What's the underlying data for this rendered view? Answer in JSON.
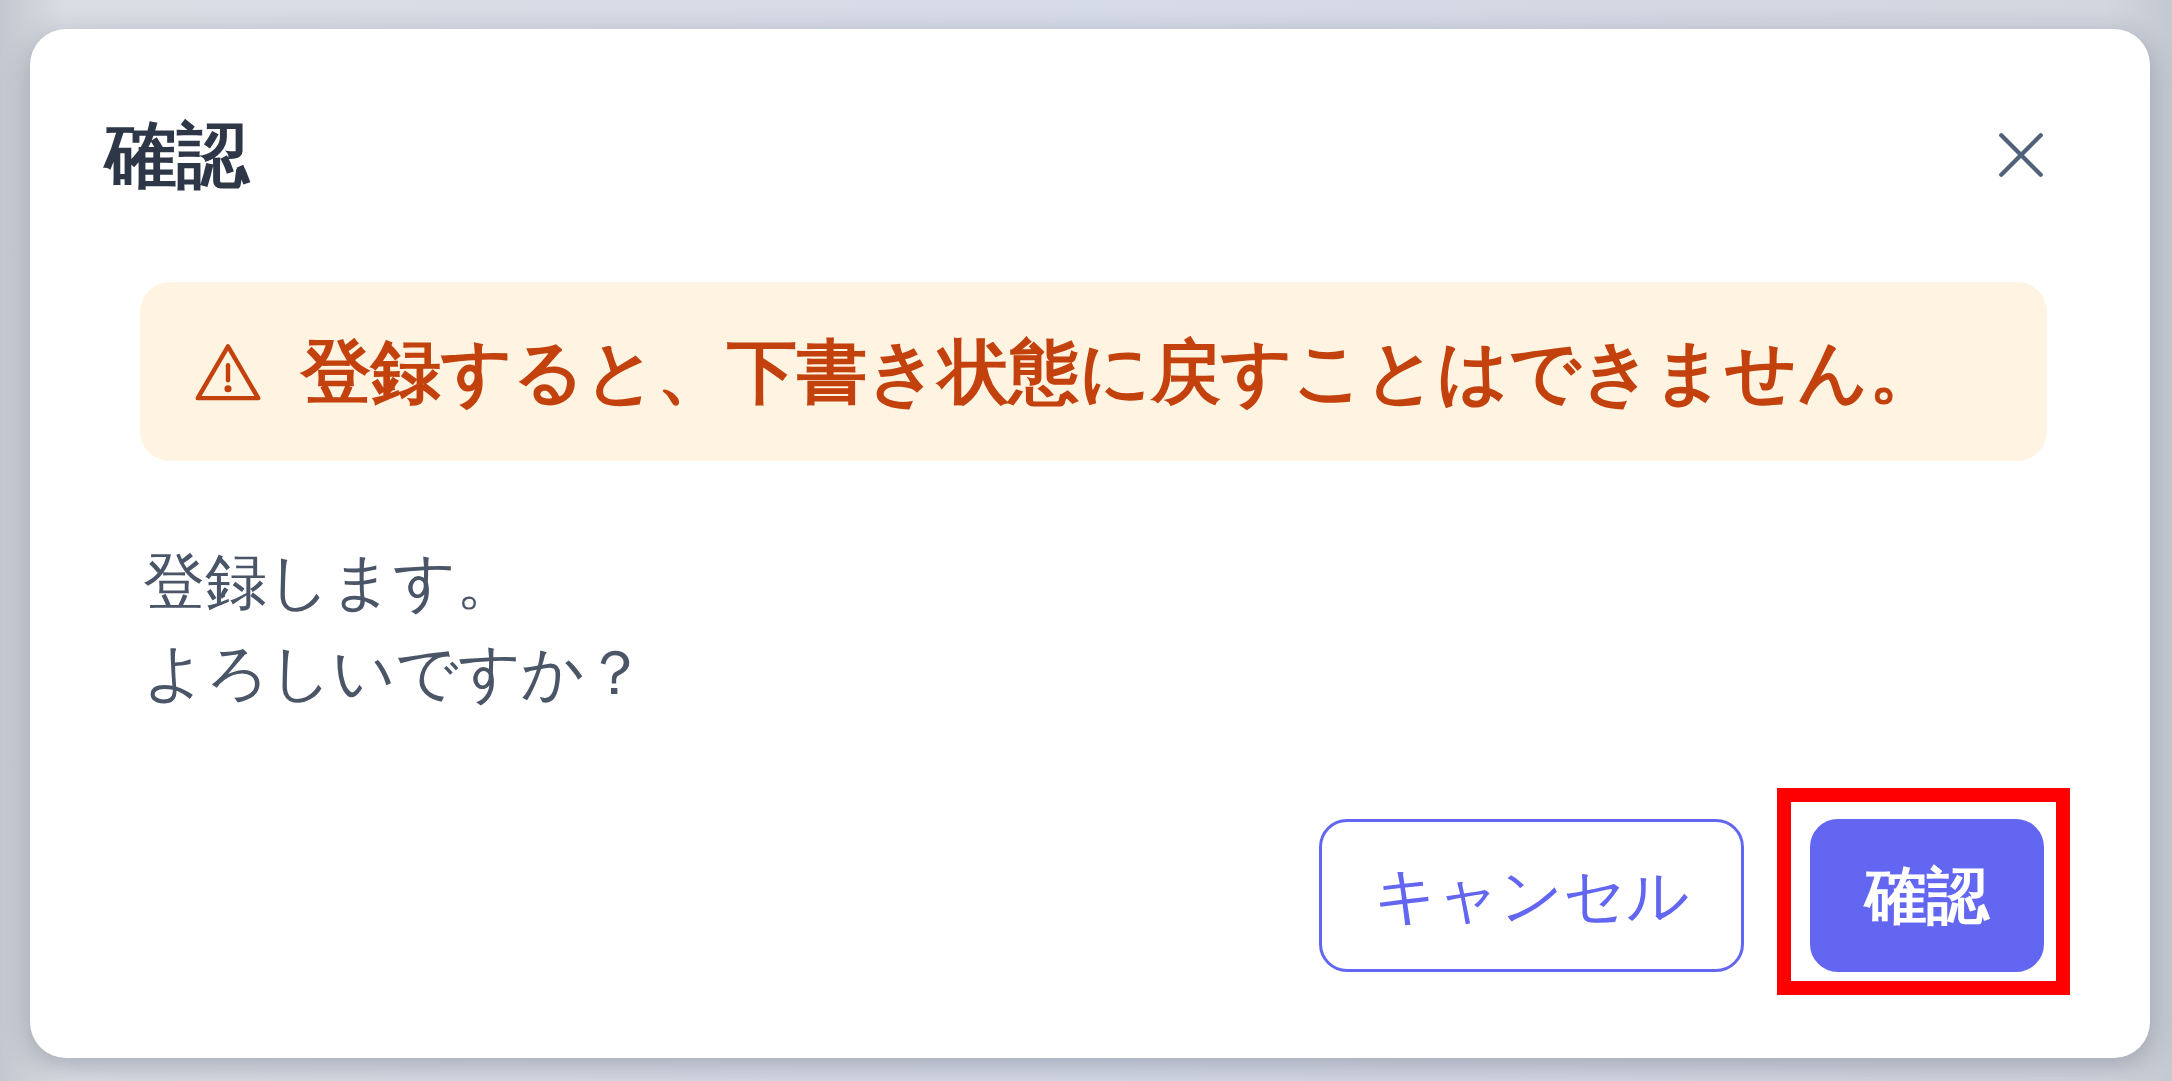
{
  "dialog": {
    "title": "確認"
  },
  "warning": {
    "text": "登録すると、下書き状態に戻すことはできません。"
  },
  "message_lines": [
    "登録します。",
    "よろしいですか？"
  ],
  "buttons": [
    {
      "label": "キャンセル",
      "kind": "secondary",
      "highlighted": false
    },
    {
      "label": "確認",
      "kind": "primary",
      "highlighted": true
    }
  ]
}
